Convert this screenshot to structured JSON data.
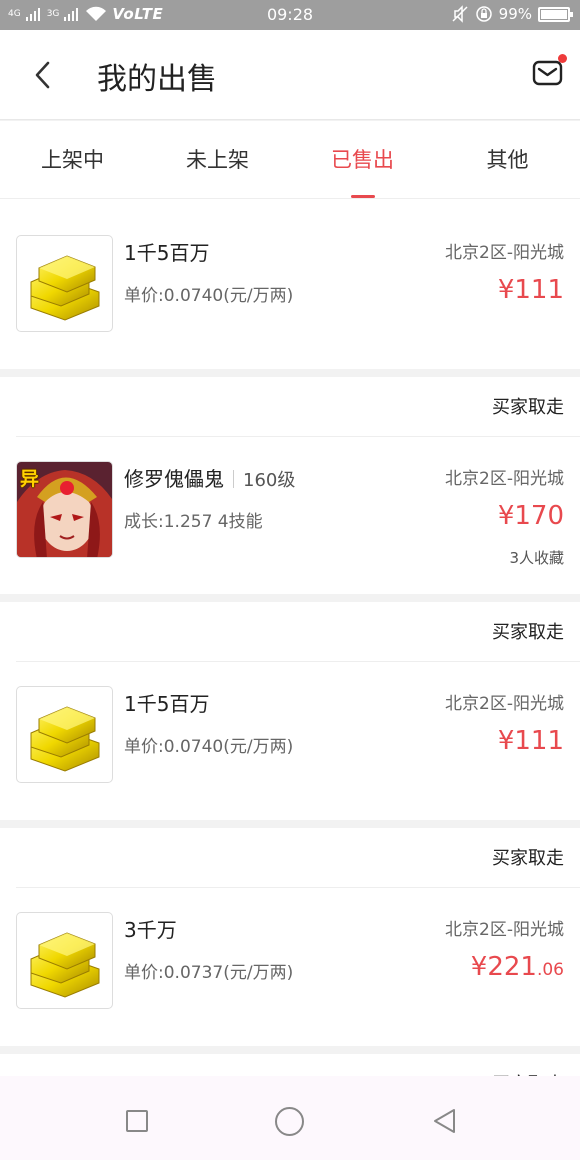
{
  "status_bar": {
    "net1": "4G",
    "net2": "3G",
    "volte": "VoLTE",
    "time": "09:28",
    "battery": "99%"
  },
  "header": {
    "title": "我的出售"
  },
  "tabs": [
    "上架中",
    "未上架",
    "已售出",
    "其他"
  ],
  "active_tab": 2,
  "colors": {
    "accent": "#e8494e",
    "status_bar": "#9e9e9e"
  },
  "items": [
    {
      "status": "",
      "icon": "gold-bars-icon",
      "title": "1千5百万",
      "level": "",
      "sub": "单价:0.0740(元/万两)",
      "server": "北京2区-阳光城",
      "price": "¥111",
      "price_cents": "",
      "fav": ""
    },
    {
      "status": "买家取走",
      "icon": "character-avatar-icon",
      "badge": "异",
      "title": "修罗傀儡鬼",
      "level": "160级",
      "sub": "成长:1.257 4技能",
      "server": "北京2区-阳光城",
      "price": "¥170",
      "price_cents": "",
      "fav": "3人收藏"
    },
    {
      "status": "买家取走",
      "icon": "gold-bars-icon",
      "title": "1千5百万",
      "level": "",
      "sub": "单价:0.0740(元/万两)",
      "server": "北京2区-阳光城",
      "price": "¥111",
      "price_cents": "",
      "fav": ""
    },
    {
      "status": "买家取走",
      "icon": "gold-bars-icon",
      "title": "3千万",
      "level": "",
      "sub": "单价:0.0737(元/万两)",
      "server": "北京2区-阳光城",
      "price": "¥221",
      "price_cents": ".06",
      "fav": ""
    },
    {
      "status": "买家取走"
    }
  ]
}
